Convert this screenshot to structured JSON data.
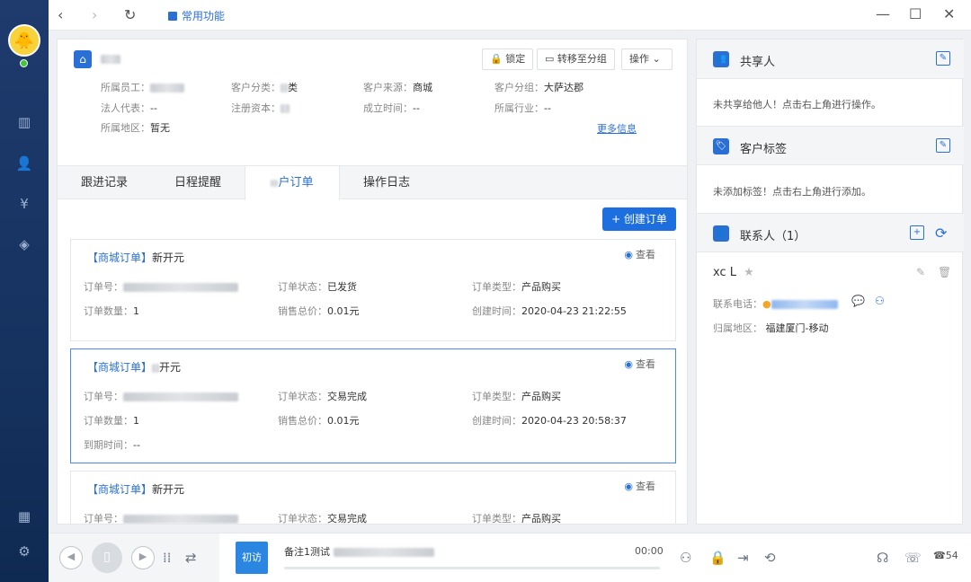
{
  "topbar": {
    "favorite_label": "常用功能",
    "back": "‹",
    "forward": "›",
    "refresh": "↻",
    "minimize": "—",
    "maximize": "☐",
    "close": "✕"
  },
  "customer": {
    "name": "",
    "buttons": {
      "lock": "锁定",
      "transfer": "转移至分组",
      "action": "操作"
    },
    "fields": {
      "staff_label": "所属员工：",
      "staff_value": "",
      "category_label": "客户分类：",
      "category_value": "类",
      "source_label": "客户来源：",
      "source_value": "商城",
      "group_label": "客户分组：",
      "group_value": "大萨达郡",
      "legal_label": "法人代表：",
      "legal_value": "--",
      "capital_label": "注册资本：",
      "capital_value": "",
      "founded_label": "成立时间：",
      "founded_value": "--",
      "industry_label": "所属行业：",
      "industry_value": "--",
      "region_label": "所属地区：",
      "region_value": "暂无"
    },
    "more_link": "更多信息"
  },
  "tabs": [
    "跟进记录",
    "日程提醒",
    "户订单",
    "操作日志"
  ],
  "create_order": "+ 创建订单",
  "orders": [
    {
      "tag": "【商城订单】",
      "title": "新开元",
      "view": "查看",
      "order_no_label": "订单号：",
      "status_label": "订单状态：",
      "status": "已发货",
      "type_label": "订单类型：",
      "type": "产品购买",
      "qty_label": "订单数量：",
      "qty": "1",
      "total_label": "销售总价：",
      "total": "0.01元",
      "created_label": "创建时间：",
      "created": "2020-04-23 21:22:55"
    },
    {
      "tag": "【商城订单】",
      "title": "开元",
      "view": "查看",
      "order_no_label": "订单号：",
      "status_label": "订单状态：",
      "status": "交易完成",
      "type_label": "订单类型：",
      "type": "产品购买",
      "qty_label": "订单数量：",
      "qty": "1",
      "total_label": "销售总价：",
      "total": "0.01元",
      "created_label": "创建时间：",
      "created": "2020-04-23 20:58:37",
      "expire_label": "到期时间：",
      "expire": "--"
    },
    {
      "tag": "【商城订单】",
      "title": "新开元",
      "view": "查看",
      "order_no_label": "订单号：",
      "status_label": "订单状态：",
      "status": "交易完成",
      "type_label": "订单类型：",
      "type": "产品购买"
    }
  ],
  "right": {
    "share_title": "共享人",
    "share_text": "未共享给他人！点击右上角进行操作。",
    "tag_title": "客户标签",
    "tag_text": "未添加标签！点击右上角进行添加。",
    "contact_title": "联系人（1）",
    "contact_name": "xc L",
    "phone_label": "联系电话：",
    "region_label": "归属地区：",
    "region_value": "福建厦门-移动"
  },
  "bottombar": {
    "first_visit": "初访",
    "note": "备注1测试",
    "time": "00:00",
    "count": "54"
  },
  "colors": {
    "accent": "#2a6fd6",
    "sidebar": "#1a3566"
  }
}
